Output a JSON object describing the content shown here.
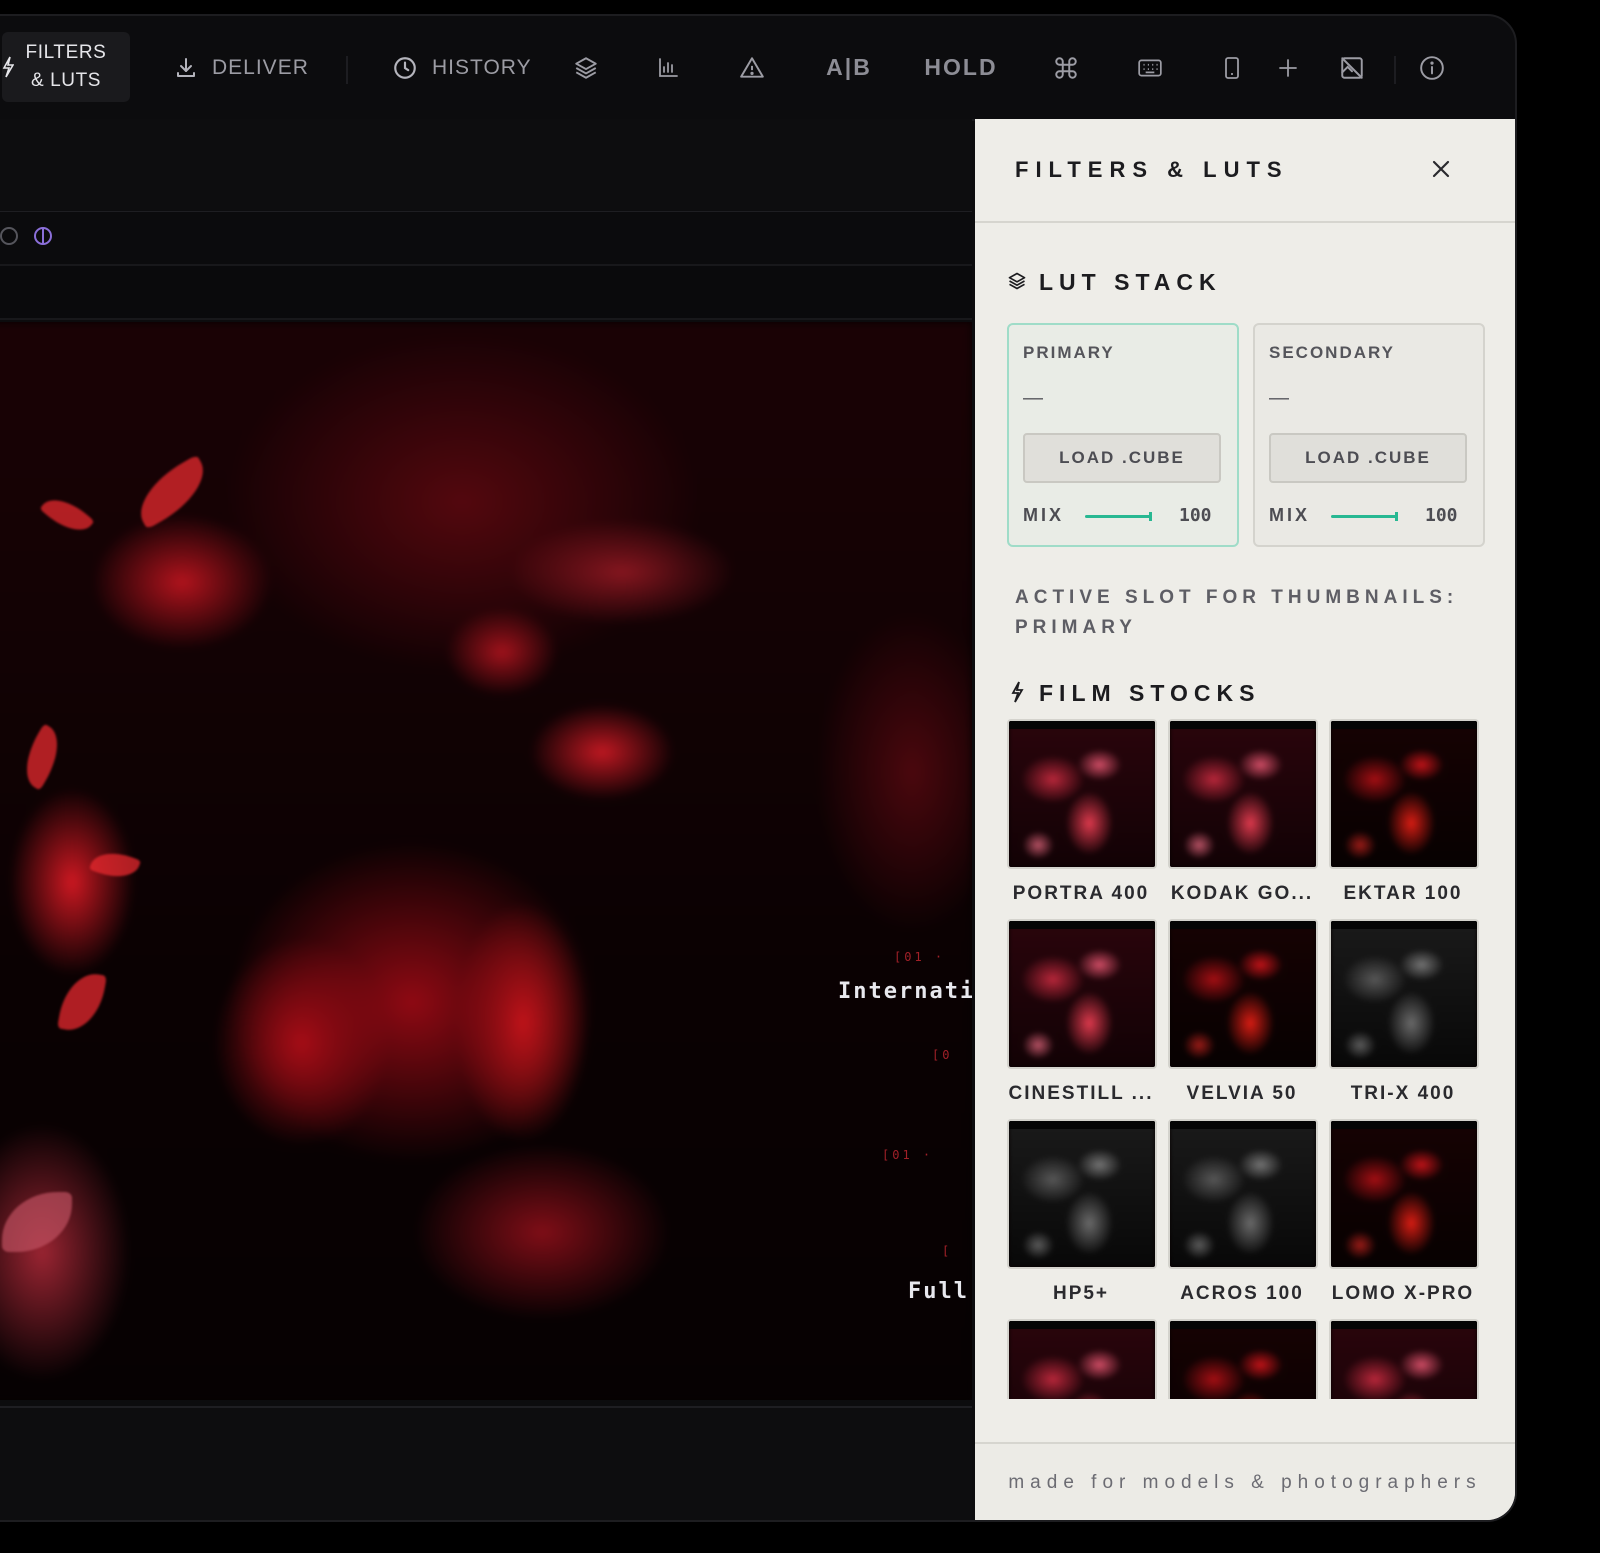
{
  "toolbar": {
    "filters_label_line1": "FILTERS",
    "filters_label_line2": "& LUTS",
    "deliver_label": "DELIVER",
    "history_label": "HISTORY",
    "ab_label": "A|B",
    "hold_label": "HOLD"
  },
  "canvas_overlay": {
    "line1": "Internatio",
    "line2": "Full"
  },
  "panel": {
    "title": "FILTERS & LUTS",
    "lut_stack_title": "LUT STACK",
    "slots": [
      {
        "label": "PRIMARY",
        "value": "—",
        "button": "LOAD .CUBE",
        "mix_label": "MIX",
        "mix_value": "100",
        "active": true
      },
      {
        "label": "SECONDARY",
        "value": "—",
        "button": "LOAD .CUBE",
        "mix_label": "MIX",
        "mix_value": "100",
        "active": false
      }
    ],
    "active_slot_note": "ACTIVE SLOT FOR THUMBNAILS: PRIMARY",
    "film_stocks_title": "FILM STOCKS",
    "film_stocks": [
      {
        "label": "PORTRA 400",
        "tone": "warm"
      },
      {
        "label": "KODAK GO...",
        "tone": "warm"
      },
      {
        "label": "EKTAR 100",
        "tone": "red"
      },
      {
        "label": "CINESTILL ...",
        "tone": "warm"
      },
      {
        "label": "VELVIA 50",
        "tone": "red"
      },
      {
        "label": "TRI-X 400",
        "tone": "mono"
      },
      {
        "label": "HP5+",
        "tone": "mono"
      },
      {
        "label": "ACROS 100",
        "tone": "mono"
      },
      {
        "label": "LOMO X-PRO",
        "tone": "red"
      },
      {
        "label": "",
        "tone": "warm"
      },
      {
        "label": "",
        "tone": "red"
      },
      {
        "label": "",
        "tone": "warm"
      }
    ],
    "footer": "made for models & photographers"
  },
  "colors": {
    "accent": "#28b892",
    "panel_bg": "#eeede8",
    "app_bg": "#0c0c0e",
    "image_red": "#c8141e"
  }
}
